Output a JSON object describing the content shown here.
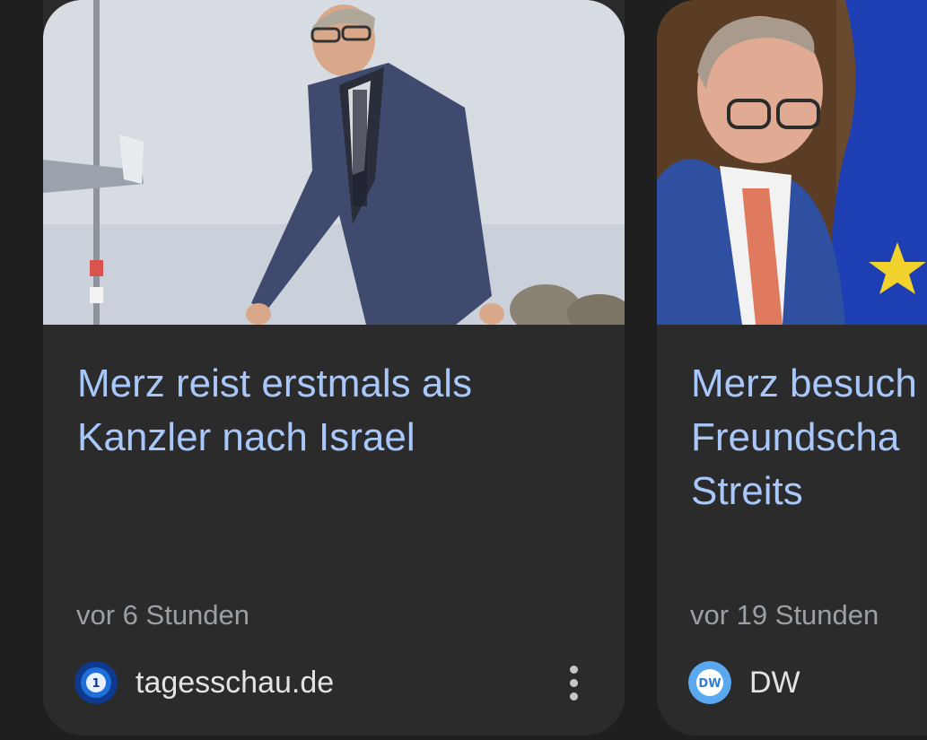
{
  "cards": [
    {
      "title": "Merz reist erstmals als\nKanzler nach Israel",
      "time": "vor 6 Stunden",
      "source": "tagesschau.de",
      "favicon": "tagesschau-logo-icon",
      "thumbnail": "photo-merz-walking-airfield"
    },
    {
      "title": "Merz besuch\nFreundscha\nStreits",
      "time": "vor 19 Stunden",
      "source": "DW",
      "favicon": "dw-logo-icon",
      "thumbnail": "photo-merz-eu-flag"
    }
  ],
  "colors": {
    "background": "#1f1f1f",
    "card": "#2b2b2c",
    "title": "#a8c7fa",
    "meta": "#9aa0a6",
    "source": "#e3e3e3"
  }
}
